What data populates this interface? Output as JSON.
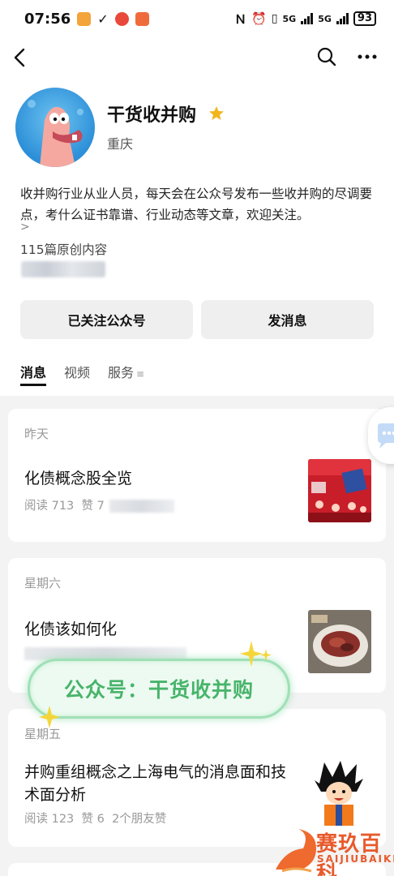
{
  "status_bar": {
    "time": "07:56",
    "network_1": "5G",
    "network_2": "5G",
    "battery": "93"
  },
  "account": {
    "name": "干货收并购",
    "region": "重庆",
    "intro": "收并购行业从业人员，每天会在公众号发布一些收并购的尽调要点，考什么证书靠谱、行业动态等文章，欢迎关注。",
    "intro_more": ">",
    "article_count": "115篇原创内容",
    "verified_color": "#f2b51d"
  },
  "actions": {
    "follow_label": "已关注公众号",
    "message_label": "发消息"
  },
  "tabs": {
    "messages": "消息",
    "videos": "视频",
    "services": "服务",
    "services_menu": "≡"
  },
  "feed": [
    {
      "date": "昨天",
      "title": "化债概念股全览",
      "reads": "阅读 713",
      "likes": "赞 7"
    },
    {
      "date": "星期六",
      "title": "化债该如何化"
    },
    {
      "date": "星期五",
      "title": "并购重组概念之上海电气的消息面和技术面分析",
      "reads": "阅读 123",
      "likes": "赞 6",
      "friends": "2个朋友赞"
    }
  ],
  "overlay": {
    "text": "公众号：干货收并购"
  },
  "watermark": {
    "text": "赛玖百科",
    "sub": "SAIJIUBAIKE",
    "color": "#e85a2b"
  }
}
